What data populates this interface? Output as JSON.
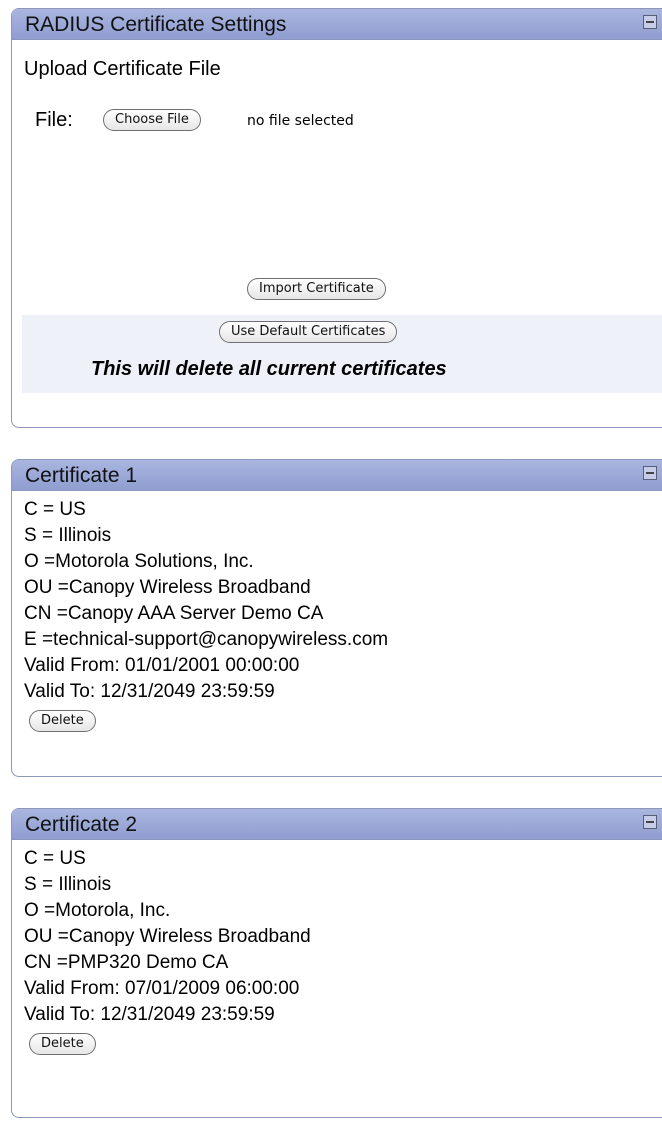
{
  "radius_panel": {
    "title": "RADIUS Certificate Settings",
    "upload_heading": "Upload Certificate File",
    "file_label": "File:",
    "choose_file_button": "Choose File",
    "file_status": "no file selected",
    "import_button": "Import Certificate",
    "default_button": "Use Default Certificates",
    "warning": "This will delete all current certificates"
  },
  "certificates": [
    {
      "title": "Certificate 1",
      "lines": [
        "C = US",
        "S = Illinois",
        "O =Motorola Solutions, Inc.",
        "OU =Canopy Wireless Broadband",
        "CN =Canopy AAA Server Demo CA",
        "E =technical-support@canopywireless.com",
        "Valid From: 01/01/2001 00:00:00",
        "Valid To: 12/31/2049 23:59:59"
      ],
      "delete_button": "Delete"
    },
    {
      "title": "Certificate 2",
      "lines": [
        "C = US",
        "S = Illinois",
        "O =Motorola, Inc.",
        "OU =Canopy Wireless Broadband",
        "CN =PMP320 Demo CA",
        "Valid From: 07/01/2009 06:00:00",
        "Valid To: 12/31/2049 23:59:59"
      ],
      "delete_button": "Delete"
    }
  ],
  "colors": {
    "header_gradient_top": "#aab6e0",
    "header_gradient_bottom": "#8f9dd0",
    "default_band": "#eef1f8"
  },
  "icons": {
    "collapse": "collapse-minus-icon"
  }
}
